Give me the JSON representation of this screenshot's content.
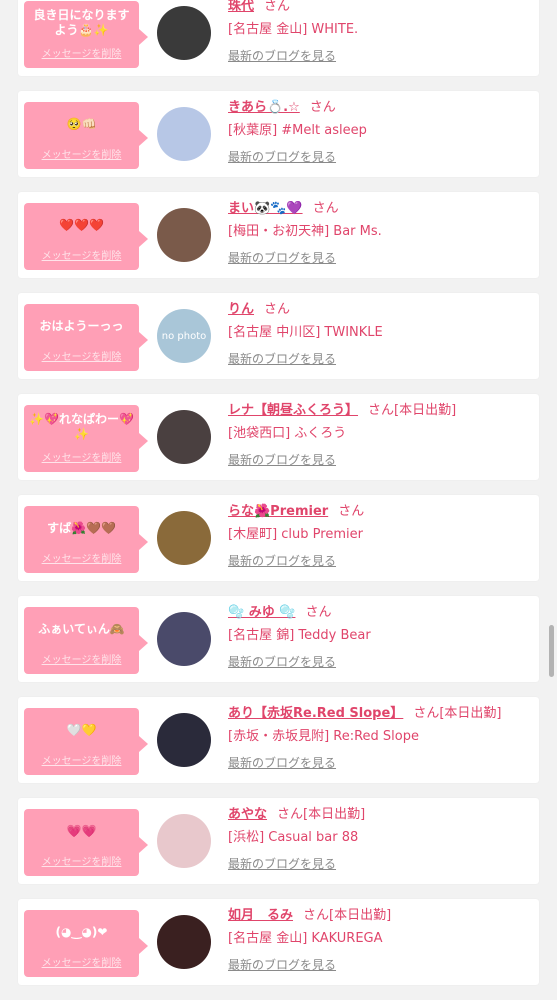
{
  "delete_label": "メッセージを削除",
  "blog_label": "最新のブログを見る",
  "san_label": "さん",
  "working_today_label": "[本日出勤]",
  "nophoto_label": "no photo",
  "colors": {
    "accent": "#e0456b",
    "bubble": "#ff9fb6",
    "background": "#f2f2f2"
  },
  "cards": [
    {
      "message": "良き日になりますよう🎂✨",
      "name": "珠代",
      "shop": "[名古屋 金山] WHITE.",
      "working": false,
      "avatar": "#3a3a3a",
      "nophoto": false
    },
    {
      "message": "🥺👊🏻",
      "name": "きあら💍.☆",
      "shop": "[秋葉原] #Melt asleep",
      "working": false,
      "avatar": "#b7c7e6",
      "nophoto": false
    },
    {
      "message": "❤️❤️❤️",
      "name": "まい🐼🐾💜",
      "shop": "[梅田・お初天神] Bar Ms.",
      "working": false,
      "avatar": "#7a5a4a",
      "nophoto": false
    },
    {
      "message": "おはようーっっ",
      "name": "りん",
      "shop": "[名古屋 中川区] TWINKLE",
      "working": false,
      "avatar": "#a9c6d8",
      "nophoto": true
    },
    {
      "message": "✨💖れなぱわー💖✨",
      "name": "レナ【朝昼ふくろう】",
      "shop": "[池袋西口] ふくろう",
      "working": true,
      "avatar": "#4a4040",
      "nophoto": false
    },
    {
      "message": "すば🌺🤎🤎",
      "name": "らな🌺Premier",
      "shop": "[木屋町] club Premier",
      "working": false,
      "avatar": "#8a6a3a",
      "nophoto": false
    },
    {
      "message": "ふぁいてぃん🙈",
      "name": "🫧 みゆ 🫧",
      "shop": "[名古屋 錦] Teddy Bear",
      "working": false,
      "avatar": "#4a4a6a",
      "nophoto": false
    },
    {
      "message": "🤍💛",
      "name": "あり【赤坂Re.Red Slope】",
      "shop": "[赤坂・赤坂見附] Re:Red Slope",
      "working": true,
      "avatar": "#2a2a3a",
      "nophoto": false
    },
    {
      "message": "💗💗",
      "name": "あやな",
      "shop": "[浜松] Casual bar 88",
      "working": true,
      "avatar": "#e8c8cc",
      "nophoto": false
    },
    {
      "message": "(◕‿◕)❤",
      "name": "如月　るみ",
      "shop": "[名古屋 金山] KAKUREGA",
      "working": true,
      "avatar": "#3a2020",
      "nophoto": false
    }
  ]
}
